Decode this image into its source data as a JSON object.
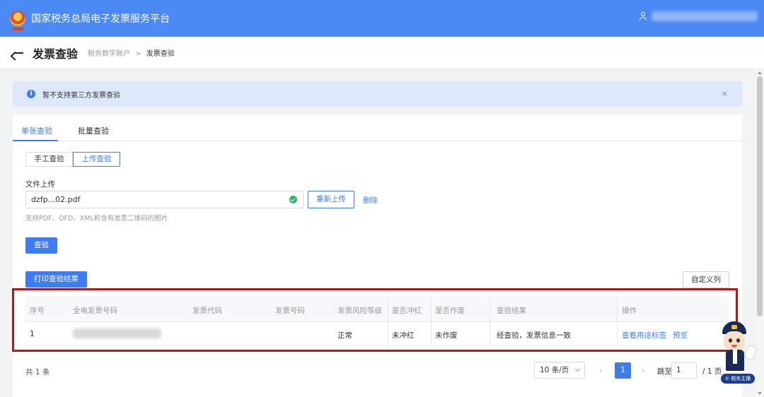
{
  "header": {
    "app_title": "国家税务总局电子发票服务平台",
    "brand_color": "#4b89f5"
  },
  "page": {
    "title": "发票查验",
    "breadcrumb": [
      "税务数字账户",
      "发票查验"
    ],
    "breadcrumb_sep": ">"
  },
  "notice": {
    "text": "暂不支持第三方发票查验",
    "close": "×"
  },
  "tabs": [
    {
      "label": "单张查验",
      "active": true
    },
    {
      "label": "批量查验",
      "active": false
    }
  ],
  "mode": {
    "manual": "手工查验",
    "upload": "上传查验",
    "selected": "上传查验"
  },
  "upload": {
    "label": "文件上传",
    "file_name": "dzfp...02.pdf",
    "reupload": "重新上传",
    "delete": "删除",
    "hint": "支持PDF、OFD、XML和含有发票二维码的图片"
  },
  "actions": {
    "verify": "查验",
    "print": "打印查验结果",
    "customize": "自定义列"
  },
  "table": {
    "headers": [
      "序号",
      "全电发票号码",
      "发票代码",
      "发票号码",
      "发票风险等级",
      "是否冲红",
      "是否作废",
      "查验结果",
      "操作"
    ],
    "rows": [
      {
        "index": "1",
        "risk": "正常",
        "red_flush": "未冲红",
        "void": "未作废",
        "result": "经查验，发票信息一致",
        "op_tag": "查看用途标签",
        "op_preview": "预览"
      }
    ]
  },
  "pagination": {
    "total": "共 1 条",
    "page_size": "10 条/页",
    "prev": "‹",
    "current": "1",
    "next": "›",
    "jump_label": "跳至",
    "jump_value": "1",
    "page_total": "/ 1 页"
  },
  "assistant": {
    "badge": "① 税务主播"
  },
  "colors": {
    "accent": "#3e7cf0",
    "highlight": "#b0191b"
  }
}
